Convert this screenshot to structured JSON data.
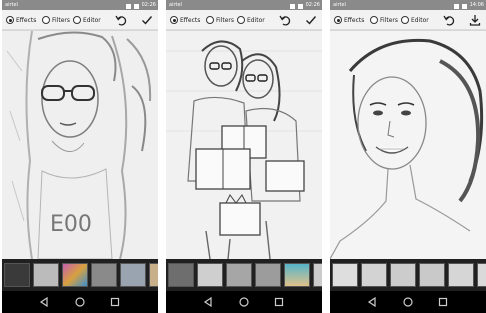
{
  "screens": [
    {
      "status": {
        "carrier": "airtel",
        "time": "02:26"
      },
      "options": [
        "Effects",
        "Filters",
        "Editor"
      ],
      "selected": "Effects",
      "actions": [
        "undo-icon",
        "check-icon"
      ],
      "scene": "single woman with glasses and hat, pencil sketch",
      "thumbs": [
        "#3a3a3a",
        "#bbbbbb",
        "#c8c8c8",
        "#c45fae",
        "#8a8a8a",
        "#9aa4b0",
        "#c7b08a"
      ]
    },
    {
      "status": {
        "carrier": "airtel",
        "time": "02:26"
      },
      "options": [
        "Effects",
        "Filters",
        "Editor"
      ],
      "selected": "Effects",
      "actions": [
        "undo-icon",
        "check-icon"
      ],
      "scene": "two women holding gift boxes, pencil sketch",
      "thumbs": [
        "#6e6e6e",
        "#cfcfcf",
        "#a6a6a6",
        "#9c9c9c",
        "#56b4c9",
        "#cccccc",
        "#d9d9d9"
      ]
    },
    {
      "status": {
        "carrier": "airtel",
        "time": "14:06"
      },
      "options": [
        "Effects",
        "Filters",
        "Editor"
      ],
      "selected": "Effects",
      "actions": [
        "undo-icon",
        "download-icon"
      ],
      "scene": "smiling woman with ponytail, pencil sketch",
      "thumbs": [
        "#dedede",
        "#d3d3d3",
        "#cccccc",
        "#c9c9c9",
        "#d6d6d6",
        "#dadada",
        "#e0e0e0"
      ]
    }
  ]
}
